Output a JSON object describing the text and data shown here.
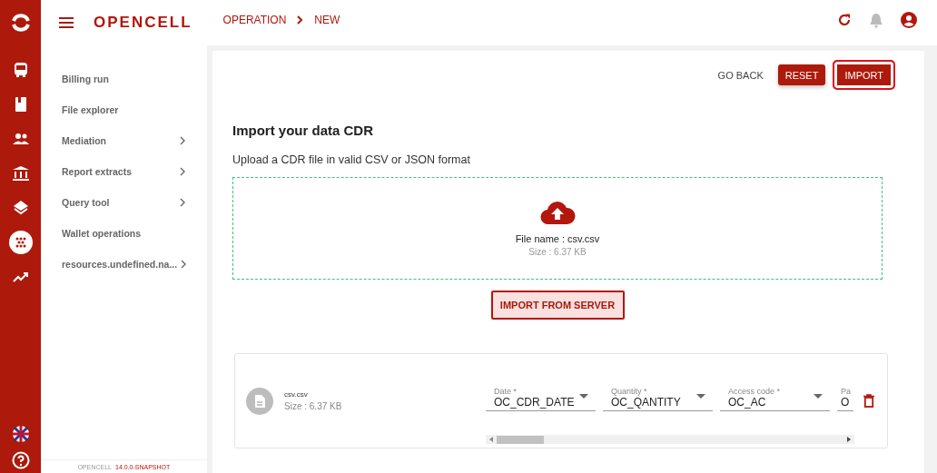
{
  "rail": {
    "items": [
      {
        "kind": "bus",
        "selected": false
      },
      {
        "kind": "book",
        "selected": false
      },
      {
        "kind": "people",
        "selected": false
      },
      {
        "kind": "bank",
        "selected": false
      },
      {
        "kind": "layers",
        "selected": false
      },
      {
        "kind": "dots",
        "selected": true
      },
      {
        "kind": "trend",
        "selected": false
      }
    ],
    "bottom": [
      {
        "kind": "flag"
      },
      {
        "kind": "help"
      }
    ]
  },
  "header": {
    "logo": "OPENCELL",
    "breadcrumb": [
      "OPERATION",
      "NEW"
    ]
  },
  "sidebar": {
    "items": [
      {
        "label": "Billing run",
        "expandable": false
      },
      {
        "label": "File explorer",
        "expandable": false
      },
      {
        "label": "Mediation",
        "expandable": true
      },
      {
        "label": "Report extracts",
        "expandable": true
      },
      {
        "label": "Query tool",
        "expandable": true
      },
      {
        "label": "Wallet operations",
        "expandable": false
      },
      {
        "label": "resources.undefined.na...",
        "expandable": true
      }
    ],
    "footer": {
      "product": "OPENCELL",
      "version": "14.0.0-SNAPSHOT"
    }
  },
  "toolbar": [
    {
      "label": "GO BACK",
      "kind": "text",
      "focused": false
    },
    {
      "label": "RESET",
      "kind": "filled",
      "focused": false
    },
    {
      "label": "IMPORT",
      "kind": "filled",
      "focused": true
    }
  ],
  "title": "Import your data CDR",
  "subtitle": "Upload a CDR file in valid CSV or JSON format",
  "dropzone": {
    "file_name": "File name : csv.csv",
    "size": "Size : 6.37 KB"
  },
  "server_button": "IMPORT FROM SERVER",
  "file": {
    "name": "csv.csv",
    "size": "Size : 6.37 KB",
    "mappings": [
      {
        "label": "Date *",
        "value": "OC_CDR_DATE"
      },
      {
        "label": "Quantity *",
        "value": "OC_QANTITY"
      },
      {
        "label": "Access code *",
        "value": "OC_AC"
      },
      {
        "label": "Pa",
        "value": "O"
      }
    ]
  }
}
